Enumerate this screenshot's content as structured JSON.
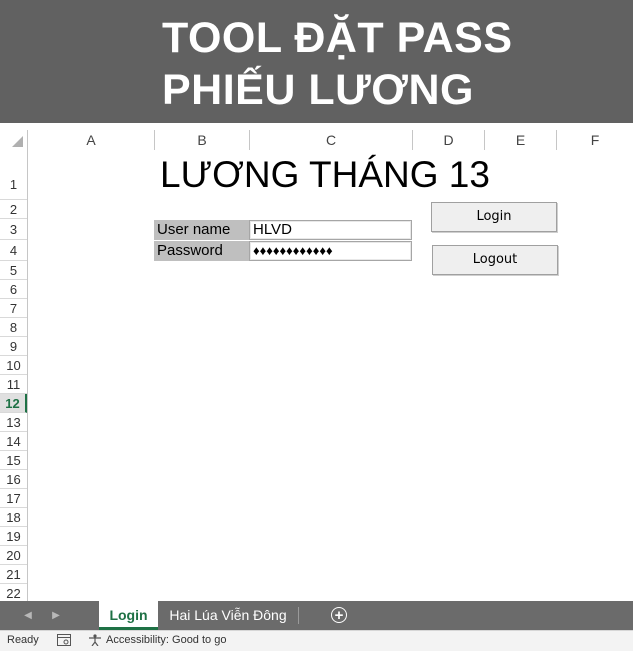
{
  "banner": {
    "line1": "TOOL ĐẶT PASS",
    "line2": "PHIẾU LƯƠNG"
  },
  "grid": {
    "columns": [
      "A",
      "B",
      "C",
      "D",
      "E",
      "F"
    ],
    "rows": [
      "1",
      "2",
      "3",
      "4",
      "5",
      "6",
      "7",
      "8",
      "9",
      "10",
      "11",
      "12",
      "13",
      "14",
      "15",
      "16",
      "17",
      "18",
      "19",
      "20",
      "21",
      "22"
    ],
    "selected_row": "12"
  },
  "sheet": {
    "title": "LƯƠNG THÁNG 13",
    "username_label": "User name",
    "username_value": "HLVD",
    "password_label": "Password",
    "password_value": "♦♦♦♦♦♦♦♦♦♦♦♦",
    "login_button": "Login",
    "logout_button": "Logout"
  },
  "tabs": {
    "items": [
      "Login",
      "Hai Lúa Viễn Đông"
    ],
    "active": "Login",
    "add_label": "+"
  },
  "status": {
    "ready": "Ready",
    "accessibility": "Accessibility: Good to go"
  },
  "colors": {
    "banner_bg": "#616161",
    "accent_green": "#1e7145",
    "label_bg": "#bfbfbf"
  }
}
